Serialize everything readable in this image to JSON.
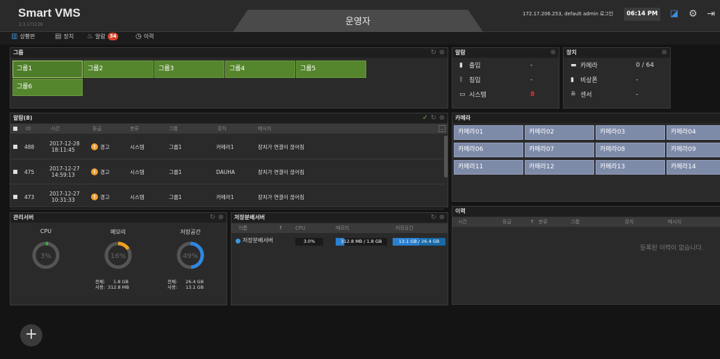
{
  "header": {
    "brand": "Smart VMS",
    "version": "2.3.171139",
    "center_title": "운영자",
    "user_info": "172.17.206.253, default admin 로그인",
    "clock": "06:14 PM"
  },
  "subnav": {
    "dashboard": "상황판",
    "devices": "장치",
    "alarms": "알람",
    "alarm_count": "34",
    "history": "이력"
  },
  "groups": {
    "title": "그룹",
    "items": [
      "그룹1",
      "그룹2",
      "그룹3",
      "그룹4",
      "그룹5",
      "그룹6"
    ]
  },
  "alarm_summary": {
    "title": "알람",
    "rows": [
      {
        "label": "출입",
        "value": "-"
      },
      {
        "label": "침입",
        "value": "-"
      },
      {
        "label": "시스템",
        "value": "8"
      }
    ]
  },
  "device_summary": {
    "title": "장치",
    "rows": [
      {
        "label": "카메라",
        "value": "0 / 64"
      },
      {
        "label": "비상폰",
        "value": "-"
      },
      {
        "label": "센서",
        "value": "-"
      }
    ]
  },
  "alarms": {
    "title": "알람(8)",
    "columns": [
      "ID",
      "시간",
      "등급",
      "분류",
      "그룹",
      "장치",
      "메시지"
    ],
    "rows": [
      {
        "id": "488",
        "date": "2017-12-28",
        "time": "18:11:45",
        "level": "경고",
        "category": "시스템",
        "group": "그룹1",
        "device": "카메라1",
        "message": "장치가 연결이 끊어짐"
      },
      {
        "id": "475",
        "date": "2017-12-27",
        "time": "14:59:13",
        "level": "경고",
        "category": "시스템",
        "group": "그룹1",
        "device": "DAUHA",
        "message": "장치가 연결이 끊어짐"
      },
      {
        "id": "473",
        "date": "2017-12-27",
        "time": "10:31:33",
        "level": "경고",
        "category": "시스템",
        "group": "그룹1",
        "device": "카메라1",
        "message": "장치가 연결이 끊어짐"
      }
    ]
  },
  "cameras": {
    "title": "카메라",
    "items": [
      "카메라01",
      "카메라02",
      "카메라03",
      "카메라04",
      "카메라06",
      "카메라07",
      "카메라08",
      "카메라09",
      "카메라11",
      "카메라12",
      "카메라13",
      "카메라14"
    ]
  },
  "mgmt": {
    "title": "관리서버",
    "gauges": [
      {
        "label": "CPU",
        "percent_text": "3%",
        "fraction": 0.03
      },
      {
        "label": "메모리",
        "percent_text": "16%",
        "fraction": 0.16
      },
      {
        "label": "저장공간",
        "percent_text": "49%",
        "fraction": 0.49
      }
    ],
    "mem_total_label": "전체:",
    "mem_total": "1.8 GB",
    "mem_used_label": "사용:",
    "mem_used": "312.8 MB",
    "disk_total_label": "전체:",
    "disk_total": "26.4 GB",
    "disk_used_label": "사용:",
    "disk_used": "13.1 GB",
    "colors": {
      "ring": "#555555",
      "cpu": "#3cb04a",
      "mem": "#f0a020",
      "disk": "#2f86e0"
    }
  },
  "storage": {
    "title": "저장분배서버",
    "columns": [
      "이름",
      "CPU",
      "메모리",
      "저장공간"
    ],
    "row": {
      "name": "저장분배서버",
      "cpu": "3.0%",
      "memory": "312.8 MB / 1.8 GB",
      "storage": "13.1 GB / 26.4 GB"
    }
  },
  "history": {
    "title": "이력",
    "columns": [
      "시간",
      "등급",
      "분류",
      "그룹",
      "장치",
      "메시지"
    ],
    "empty": "등록된 이력이 없습니다."
  }
}
